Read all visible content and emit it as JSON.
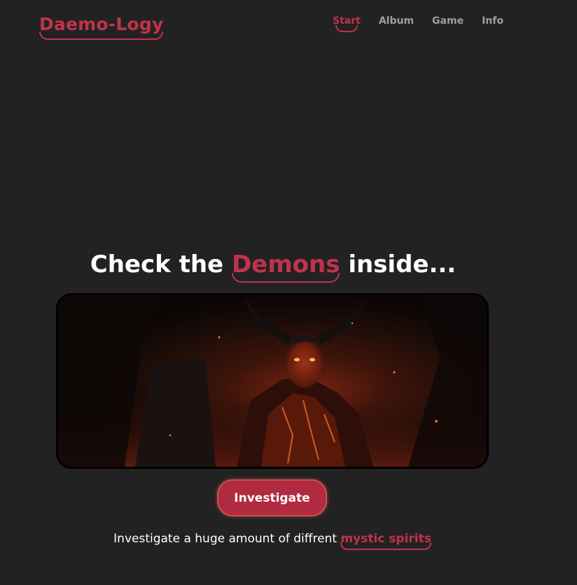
{
  "header": {
    "logo": "Daemo-Logy",
    "nav": [
      {
        "label": "Start",
        "active": true
      },
      {
        "label": "Album",
        "active": false
      },
      {
        "label": "Game",
        "active": false
      },
      {
        "label": "Info",
        "active": false
      }
    ]
  },
  "hero": {
    "heading_before": "Check the",
    "heading_accent": "Demons",
    "heading_after": "inside...",
    "image_icon": "demon-image",
    "cta_label": "Investigate",
    "tagline_before": "Investigate a huge amount of diffrent",
    "tagline_accent": "mystic spirits"
  },
  "colors": {
    "background": "#222222",
    "accent": "#c0334b",
    "nav_inactive": "#9e9e9e",
    "button_bg": "#b02a40",
    "text": "#ffffff"
  }
}
